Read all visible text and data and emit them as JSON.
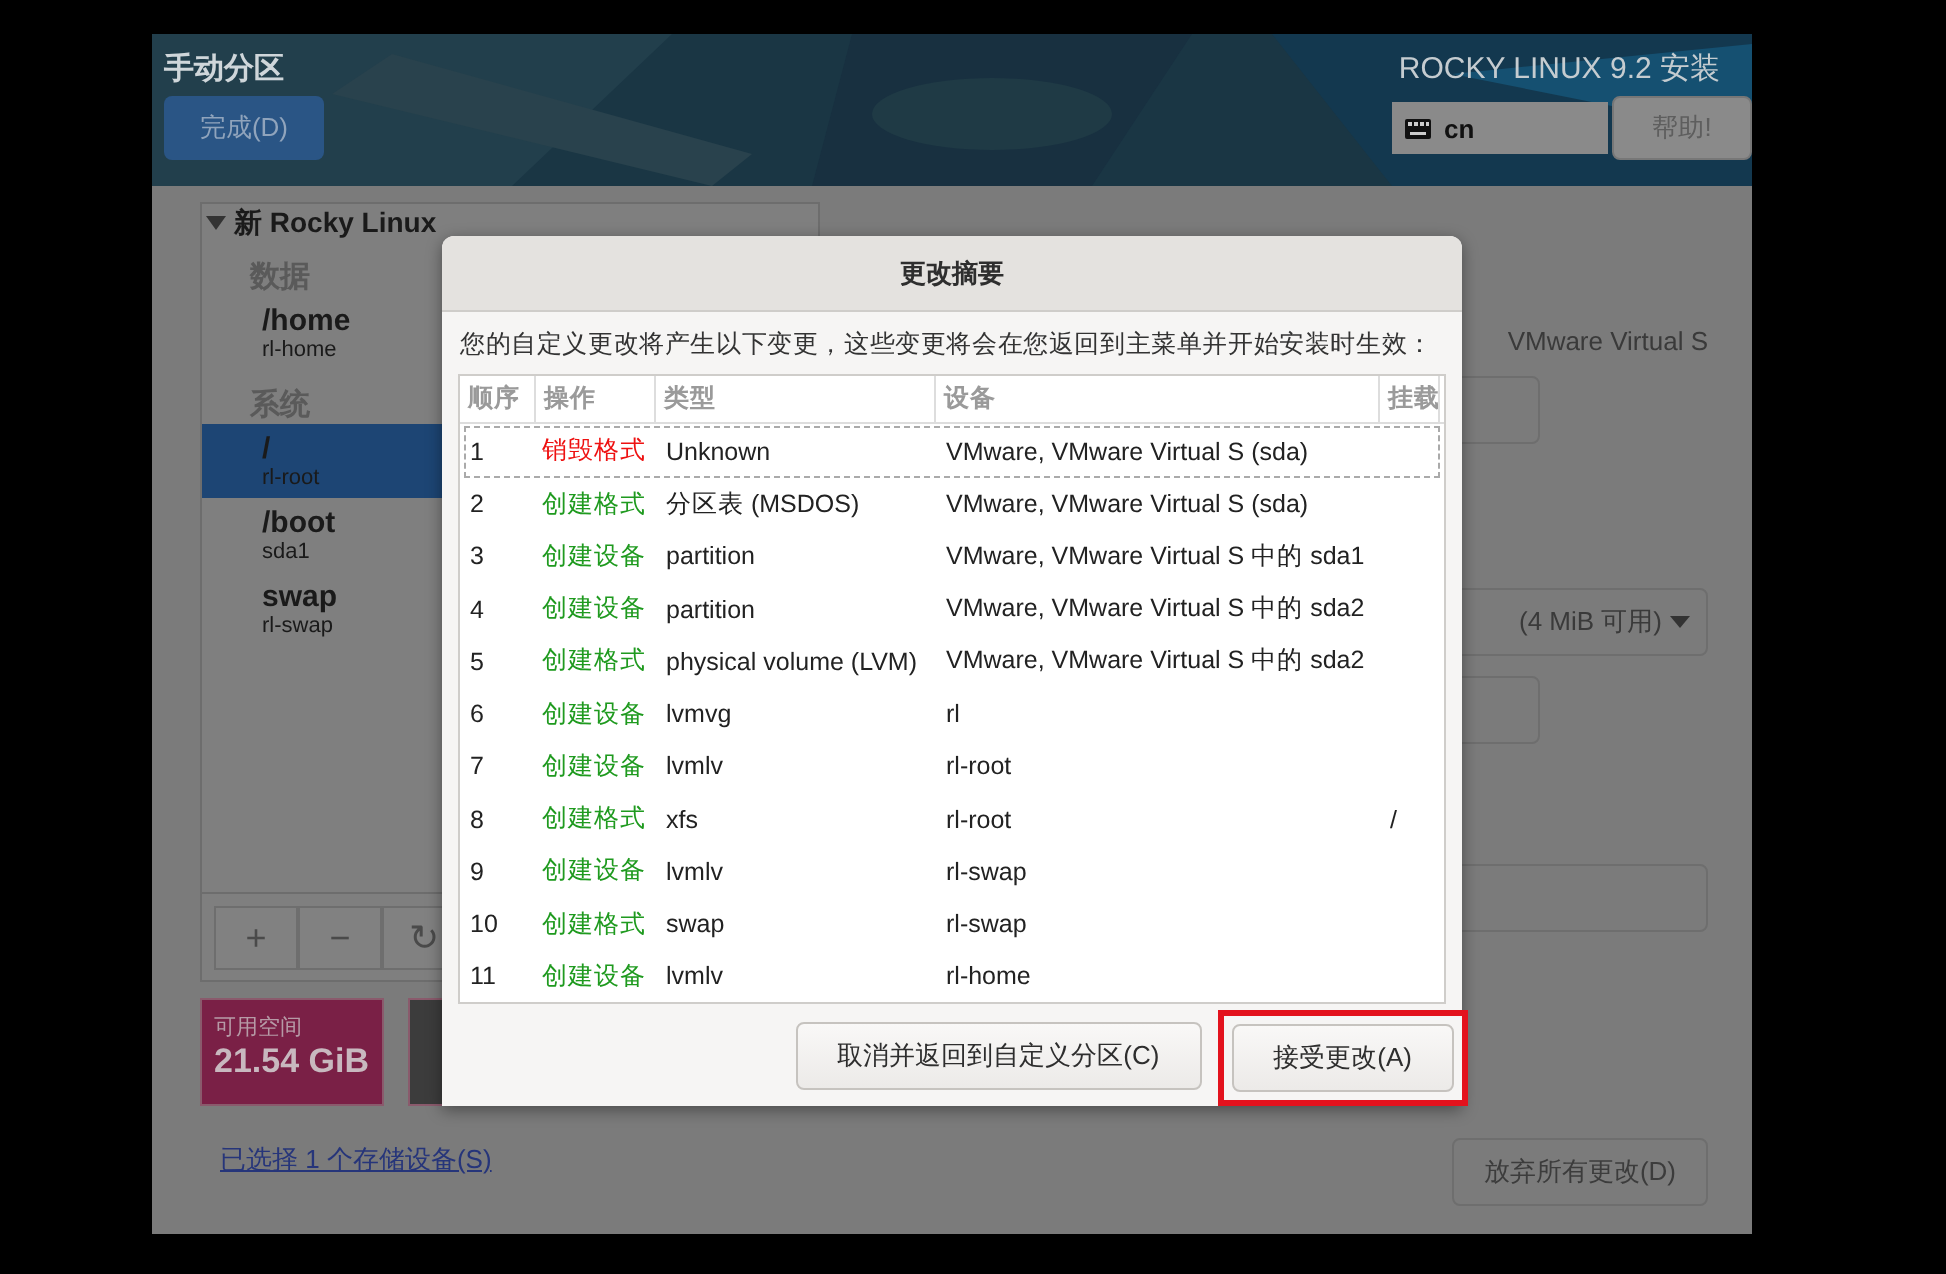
{
  "header": {
    "title": "手动分区",
    "done_button": "完成(D)",
    "product": "ROCKY LINUX 9.2 安装",
    "keyboard": "cn",
    "help_button": "帮助!"
  },
  "partitions": {
    "installation": "新 Rocky Linux",
    "expanded": true,
    "groups": [
      {
        "label": "数据",
        "items": [
          {
            "mount": "/home",
            "device": "rl-home",
            "selected": false
          }
        ]
      },
      {
        "label": "系统",
        "items": [
          {
            "mount": "/",
            "device": "rl-root",
            "selected": true
          },
          {
            "mount": "/boot",
            "device": "sda1",
            "selected": false
          },
          {
            "mount": "swap",
            "device": "rl-swap",
            "selected": false
          }
        ]
      }
    ],
    "toolbar": [
      "+",
      "−",
      "↻"
    ]
  },
  "space": {
    "available_label": "可用空间",
    "available_value": "21.54 GiB"
  },
  "storage_link": "已选择 1 个存储设备(S)",
  "details": {
    "device_text": "VMware Virtual S",
    "volume_group": "(4 MiB 可用)",
    "discard_button": "放弃所有更改(D)"
  },
  "dialog": {
    "title": "更改摘要",
    "message": "您的自定义更改将产生以下变更，这些变更将会在您返回到主菜单并开始安装时生效：",
    "columns": [
      "顺序",
      "操作",
      "类型",
      "设备",
      "挂载"
    ],
    "rows": [
      {
        "order": "1",
        "action": "销毁格式",
        "kind": "destroy",
        "type": "Unknown",
        "device": "VMware, VMware Virtual S (sda)",
        "mount": "",
        "focused": true
      },
      {
        "order": "2",
        "action": "创建格式",
        "kind": "create",
        "type": "分区表 (MSDOS)",
        "device": "VMware, VMware Virtual S (sda)",
        "mount": "",
        "focused": false
      },
      {
        "order": "3",
        "action": "创建设备",
        "kind": "create",
        "type": "partition",
        "device": "VMware, VMware Virtual S 中的 sda1",
        "mount": "",
        "focused": false
      },
      {
        "order": "4",
        "action": "创建设备",
        "kind": "create",
        "type": "partition",
        "device": "VMware, VMware Virtual S 中的 sda2",
        "mount": "",
        "focused": false
      },
      {
        "order": "5",
        "action": "创建格式",
        "kind": "create",
        "type": "physical volume (LVM)",
        "device": "VMware, VMware Virtual S 中的 sda2",
        "mount": "",
        "focused": false
      },
      {
        "order": "6",
        "action": "创建设备",
        "kind": "create",
        "type": "lvmvg",
        "device": "rl",
        "mount": "",
        "focused": false
      },
      {
        "order": "7",
        "action": "创建设备",
        "kind": "create",
        "type": "lvmlv",
        "device": "rl-root",
        "mount": "",
        "focused": false
      },
      {
        "order": "8",
        "action": "创建格式",
        "kind": "create",
        "type": "xfs",
        "device": "rl-root",
        "mount": "/",
        "focused": false
      },
      {
        "order": "9",
        "action": "创建设备",
        "kind": "create",
        "type": "lvmlv",
        "device": "rl-swap",
        "mount": "",
        "focused": false
      },
      {
        "order": "10",
        "action": "创建格式",
        "kind": "create",
        "type": "swap",
        "device": "rl-swap",
        "mount": "",
        "focused": false
      },
      {
        "order": "11",
        "action": "创建设备",
        "kind": "create",
        "type": "lvmlv",
        "device": "rl-home",
        "mount": "",
        "focused": false
      }
    ],
    "cancel_button": "取消并返回到自定义分区(C)",
    "accept_button": "接受更改(A)",
    "accept_highlighted": true
  }
}
